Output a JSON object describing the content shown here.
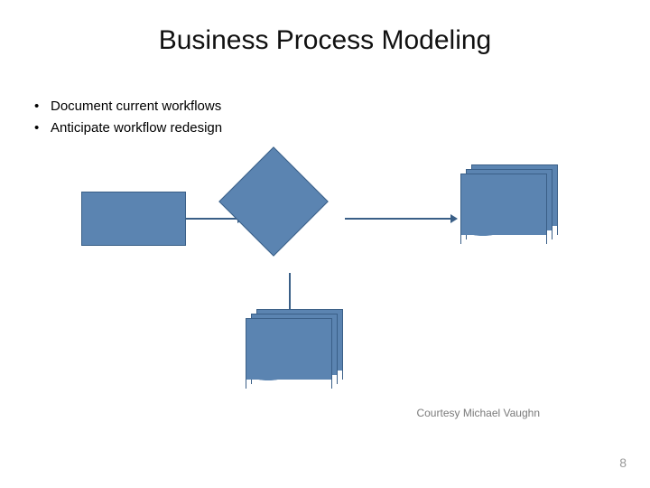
{
  "title": "Business Process Modeling",
  "bullets": [
    "Document current workflows",
    "Anticipate workflow redesign"
  ],
  "diagram": {
    "shapes": {
      "process1": {
        "name": "process-box"
      },
      "decision": {
        "name": "decision-diamond"
      },
      "docstack_right": {
        "name": "document-stack-right"
      },
      "docstack_bottom": {
        "name": "document-stack-bottom"
      }
    },
    "colors": {
      "fill": "#5b84b1",
      "stroke": "#3a5f87"
    }
  },
  "credit": "Courtesy Michael Vaughn",
  "page_number": "8"
}
